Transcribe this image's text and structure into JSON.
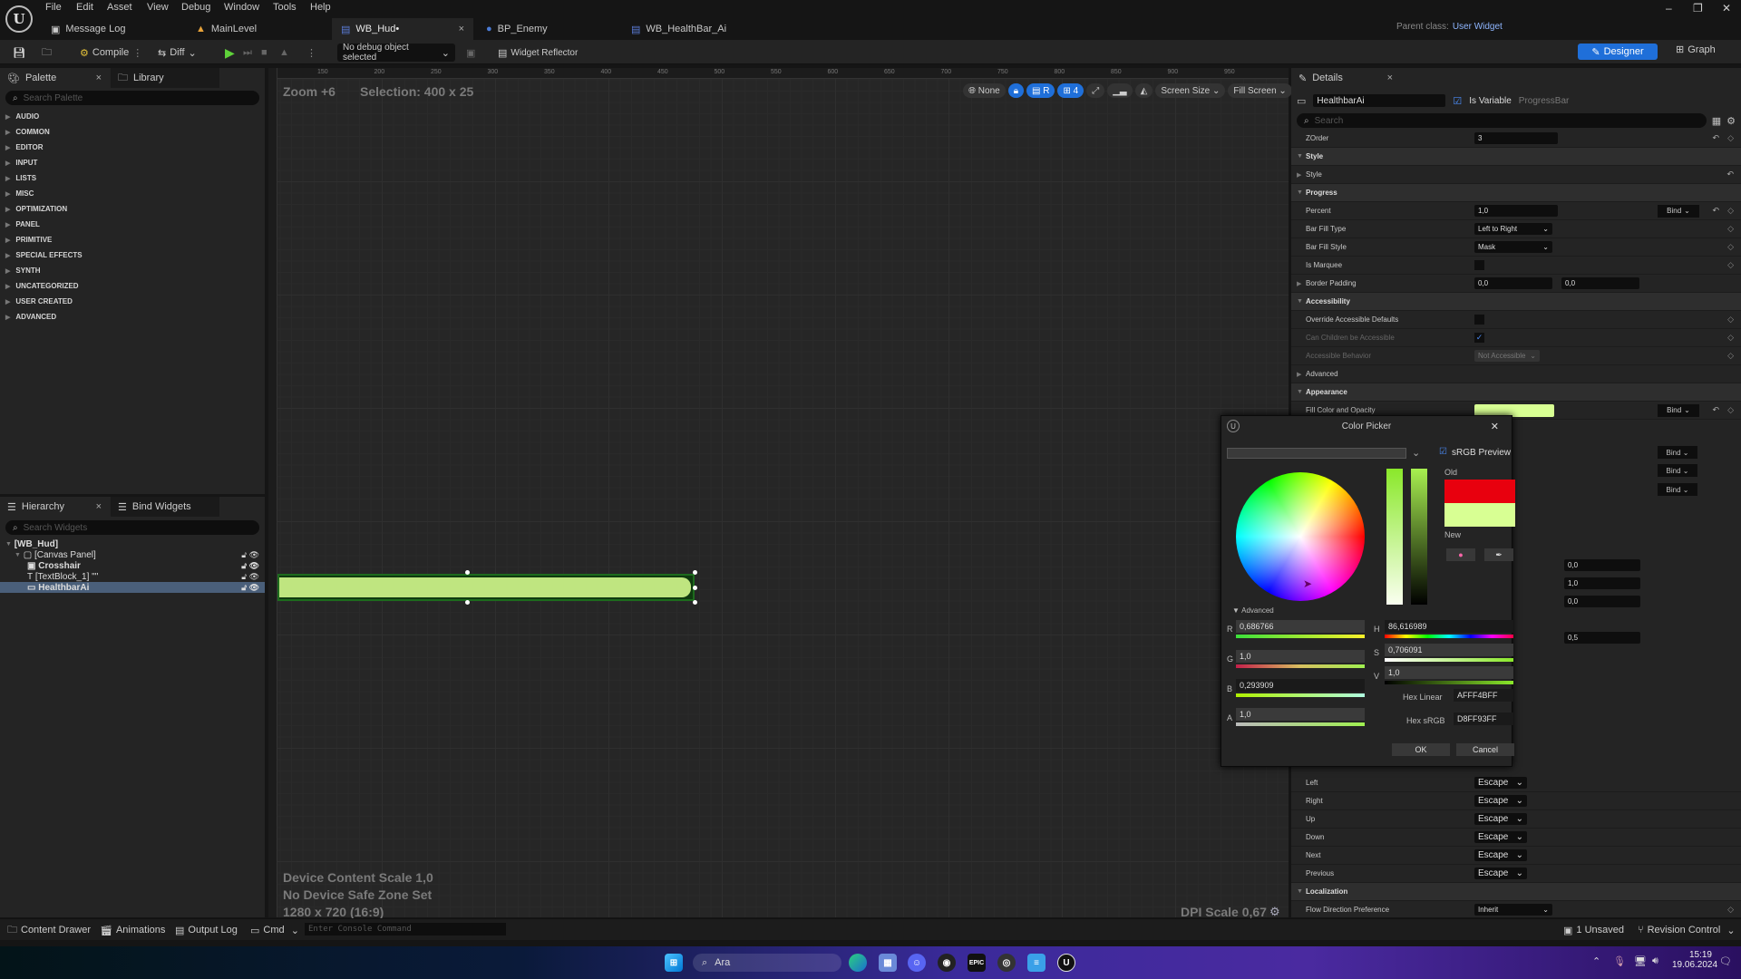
{
  "menu": [
    "File",
    "Edit",
    "Asset",
    "View",
    "Debug",
    "Window",
    "Tools",
    "Help"
  ],
  "tabs": [
    {
      "label": "Message Log",
      "icon": "log-icon"
    },
    {
      "label": "MainLevel",
      "icon": "level-icon"
    },
    {
      "label": "WB_Hud•",
      "icon": "widget-blueprint-icon",
      "active": true
    },
    {
      "label": "BP_Enemy",
      "icon": "blueprint-icon"
    },
    {
      "label": "WB_HealthBar_Ai",
      "icon": "widget-blueprint-icon"
    }
  ],
  "parent_class": {
    "label": "Parent class:",
    "value": "User Widget"
  },
  "toolbar": {
    "compile": "Compile",
    "diff": "Diff",
    "debug_object": "No debug object selected",
    "widget_reflector": "Widget Reflector",
    "designer": "Designer",
    "graph": "Graph"
  },
  "palette": {
    "tab": "Palette",
    "library_tab": "Library",
    "search_placeholder": "Search Palette",
    "categories": [
      "AUDIO",
      "COMMON",
      "EDITOR",
      "INPUT",
      "LISTS",
      "MISC",
      "OPTIMIZATION",
      "PANEL",
      "PRIMITIVE",
      "SPECIAL EFFECTS",
      "SYNTH",
      "UNCATEGORIZED",
      "USER CREATED",
      "ADVANCED"
    ]
  },
  "hierarchy": {
    "tab": "Hierarchy",
    "bind_tab": "Bind Widgets",
    "search_placeholder": "Search Widgets",
    "items": [
      {
        "label": "[WB_Hud]"
      },
      {
        "label": "[Canvas Panel]"
      },
      {
        "label": "Crosshair"
      },
      {
        "label": "[TextBlock_1] \"\""
      },
      {
        "label": "HealthbarAi",
        "selected": true
      }
    ]
  },
  "viewport": {
    "zoom": "Zoom +6",
    "selection": "Selection: 400 x 25",
    "ruler_ticks": [
      "150",
      "200",
      "250",
      "300",
      "350",
      "400",
      "450",
      "500",
      "550",
      "600",
      "650",
      "700",
      "750",
      "800",
      "850",
      "900",
      "950"
    ],
    "tools": {
      "none": "None",
      "r": "R",
      "grid": "4",
      "screen_size": "Screen Size",
      "fill_screen": "Fill Screen"
    },
    "info": [
      "Device Content Scale 1,0",
      "No Device Safe Zone Set",
      "1280 x 720 (16:9)"
    ],
    "dpi": "DPI Scale 0,67",
    "healthbar_color": "#bfe580",
    "healthbar_percent": 1.0
  },
  "details": {
    "tab": "Details",
    "name": "HealthbarAi",
    "is_variable": "Is Variable",
    "class": "ProgressBar",
    "search_placeholder": "Search",
    "rows": [
      {
        "type": "row",
        "label": "ZOrder",
        "value": "3"
      },
      {
        "type": "section",
        "label": "Style"
      },
      {
        "type": "sub",
        "label": "Style"
      },
      {
        "type": "section",
        "label": "Progress"
      },
      {
        "type": "row",
        "label": "Percent",
        "value": "1,0",
        "bind": "Bind"
      },
      {
        "type": "row",
        "label": "Bar Fill Type",
        "value": "Left to Right",
        "dropdown": true
      },
      {
        "type": "row",
        "label": "Bar Fill Style",
        "value": "Mask",
        "dropdown": true
      },
      {
        "type": "row",
        "label": "Is Marquee",
        "checkbox": false
      },
      {
        "type": "sub",
        "label": "Border Padding",
        "value": "0,0",
        "value2": "0,0"
      },
      {
        "type": "section",
        "label": "Accessibility"
      },
      {
        "type": "row",
        "label": "Override Accessible Defaults",
        "checkbox": false
      },
      {
        "type": "row",
        "label": "Can Children be Accessible",
        "checkbox": true,
        "disabled": true
      },
      {
        "type": "row",
        "label": "Accessible Behavior",
        "value": "Not Accessible",
        "dropdown": true,
        "disabled": true
      },
      {
        "type": "sub",
        "label": "Advanced"
      },
      {
        "type": "section",
        "label": "Appearance"
      },
      {
        "type": "color",
        "label": "Fill Color and Opacity",
        "bind": "Bind"
      }
    ],
    "partial_values": [
      "0,0",
      "1,0",
      "0,0",
      "0,5"
    ],
    "bind_labels": [
      "Bind",
      "Bind",
      "Bind"
    ],
    "navigation": [
      {
        "label": "Left",
        "value": "Escape"
      },
      {
        "label": "Right",
        "value": "Escape"
      },
      {
        "label": "Up",
        "value": "Escape"
      },
      {
        "label": "Down",
        "value": "Escape"
      },
      {
        "label": "Next",
        "value": "Escape"
      },
      {
        "label": "Previous",
        "value": "Escape"
      }
    ],
    "localization": {
      "section": "Localization",
      "label": "Flow Direction Preference",
      "value": "Inherit"
    }
  },
  "color_picker": {
    "title": "Color Picker",
    "srgb_preview": "sRGB Preview",
    "old_label": "Old",
    "new_label": "New",
    "advanced": "Advanced",
    "old_color": "#e8000e",
    "new_color": "#d8ff93",
    "R": "0,686766",
    "G": "1,0",
    "B": "0,293909",
    "A": "1,0",
    "H": "86,616989",
    "S": "0,706091",
    "V": "1,0",
    "hex_linear_label": "Hex Linear",
    "hex_linear": "AFFF4BFF",
    "hex_srgb_label": "Hex sRGB",
    "hex_srgb": "D8FF93FF",
    "ok": "OK",
    "cancel": "Cancel"
  },
  "bottombar": {
    "content_drawer": "Content Drawer",
    "animations": "Animations",
    "output_log": "Output Log",
    "cmd": "Cmd",
    "console_placeholder": "Enter Console Command",
    "unsaved": "1 Unsaved",
    "revision_control": "Revision Control"
  },
  "taskbar": {
    "search": "Ara",
    "time": "15:19",
    "date": "19.06.2024"
  }
}
